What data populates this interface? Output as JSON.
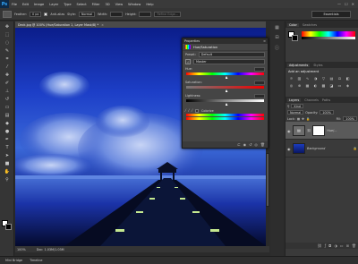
{
  "menubar": {
    "logo": "Ps",
    "items": [
      "File",
      "Edit",
      "Image",
      "Layer",
      "Type",
      "Select",
      "Filter",
      "3D",
      "View",
      "Window",
      "Help"
    ],
    "window_controls": [
      "—",
      "☐",
      "✕"
    ]
  },
  "options": {
    "feather_label": "Feather:",
    "feather_value": "0 px",
    "antialias_label": "Anti-alias",
    "style_label": "Style:",
    "style_value": "Normal",
    "width_label": "Width:",
    "height_label": "Height:",
    "refine_label": "Refine Edge...",
    "workspace": "Essentials"
  },
  "document": {
    "tab_title": "Deck.jpg @ 100% (Hue/Saturation 1, Layer Mask/8) *",
    "zoom": "100%",
    "doc_size": "Doc: 1.03M/1.03M"
  },
  "minibridge": {
    "label": "Mini Bridge",
    "timeline": "Timeline"
  },
  "properties": {
    "panel_title": "Properties",
    "adj_title": "Hue/Saturation",
    "preset_label": "Preset:",
    "preset_value": "Default",
    "channel_value": "Master",
    "hue_label": "Hue:",
    "saturation_label": "Saturation:",
    "lightness_label": "Lightness:",
    "colorize_label": "Colorize"
  },
  "right": {
    "color_tabs": [
      "Color",
      "Swatches"
    ],
    "adj_tabs": [
      "Adjustments",
      "Styles"
    ],
    "adj_title": "Add an adjustment",
    "layers_tabs": [
      "Layers",
      "Channels",
      "Paths"
    ],
    "kind_label": "Kind",
    "blend_mode": "Normal",
    "opacity_label": "Opacity:",
    "opacity_value": "100%",
    "lock_label": "Lock:",
    "fill_label": "Fill:",
    "fill_value": "100%",
    "layers": [
      {
        "name": "Hue/...",
        "type": "adjustment",
        "selected": true
      },
      {
        "name": "Background",
        "type": "image",
        "selected": false
      }
    ]
  },
  "colors": {
    "accent": "#31a8ff",
    "chrome": "#353535",
    "panel": "#454545"
  }
}
